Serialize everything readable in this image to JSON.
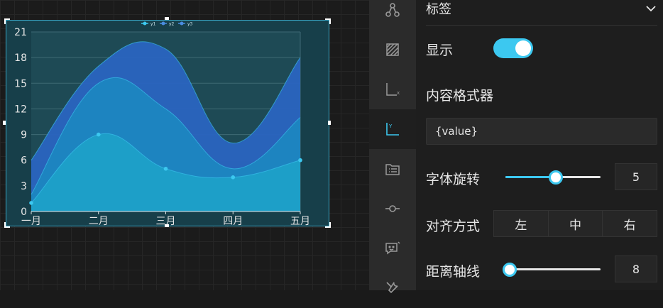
{
  "panel": {
    "section_title": "标签",
    "show_label": "显示",
    "show_enabled": true,
    "formatter_label": "内容格式器",
    "formatter_value": "{value}",
    "rotate_label": "字体旋转",
    "rotate_value": "5",
    "align_label": "对齐方式",
    "align_options": [
      "左",
      "中",
      "右"
    ],
    "distance_label": "距离轴线",
    "distance_value": "8"
  },
  "rail": {
    "icons": [
      "graph-nodes-icon",
      "grid-area-icon",
      "x-axis-icon",
      "y-axis-icon",
      "legend-list-icon",
      "series-line-icon",
      "tooltip-icon",
      "tools-icon"
    ],
    "active": "y-axis-icon",
    "x_axis_letter": "x",
    "y_axis_letter": "Y"
  },
  "chart_data": {
    "type": "area",
    "categories": [
      "一月",
      "二月",
      "三月",
      "四月",
      "五月"
    ],
    "series": [
      {
        "name": "y1",
        "values": [
          1,
          9,
          5,
          4,
          6
        ],
        "color": "#1ea0c8"
      },
      {
        "name": "y2",
        "values": [
          2,
          15,
          12,
          5,
          11
        ],
        "color": "#1c86c0"
      },
      {
        "name": "y3",
        "values": [
          6,
          17,
          19,
          8,
          18
        ],
        "color": "#2a64c0"
      }
    ],
    "yticks": [
      0,
      3,
      6,
      9,
      12,
      15,
      18,
      21
    ],
    "ylim": [
      0,
      21
    ],
    "legend": "top-center",
    "grid": true
  }
}
